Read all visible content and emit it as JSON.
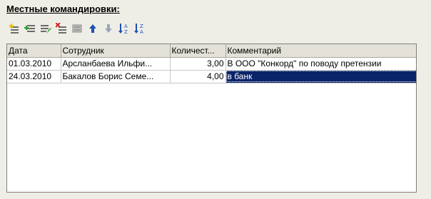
{
  "section_title": "Местные командировки:",
  "toolbar": {
    "buttons": [
      {
        "icon": "add-row-icon"
      },
      {
        "icon": "add-copy-icon"
      },
      {
        "icon": "edit-row-icon"
      },
      {
        "icon": "delete-row-icon"
      },
      {
        "icon": "end-edit-icon"
      },
      {
        "icon": "move-up-icon"
      },
      {
        "icon": "move-down-icon"
      },
      {
        "icon": "sort-ascending-icon"
      },
      {
        "icon": "sort-descending-icon"
      }
    ]
  },
  "table": {
    "columns": [
      "Дата",
      "Сотрудник",
      "Количест...",
      "Комментарий"
    ],
    "rows": [
      {
        "date": "01.03.2010",
        "employee": "Арсланбаева Ильфи...",
        "quantity": "3,00",
        "comment": "В ООО \"Конкорд\" по поводу претензии"
      },
      {
        "date": "24.03.2010",
        "employee": "Бакалов Борис Семе...",
        "quantity": "4,00",
        "comment": "в банк"
      }
    ]
  },
  "colors": {
    "background": "#efeee6",
    "header": "#e4e2d8",
    "selection": "#0a246a"
  }
}
